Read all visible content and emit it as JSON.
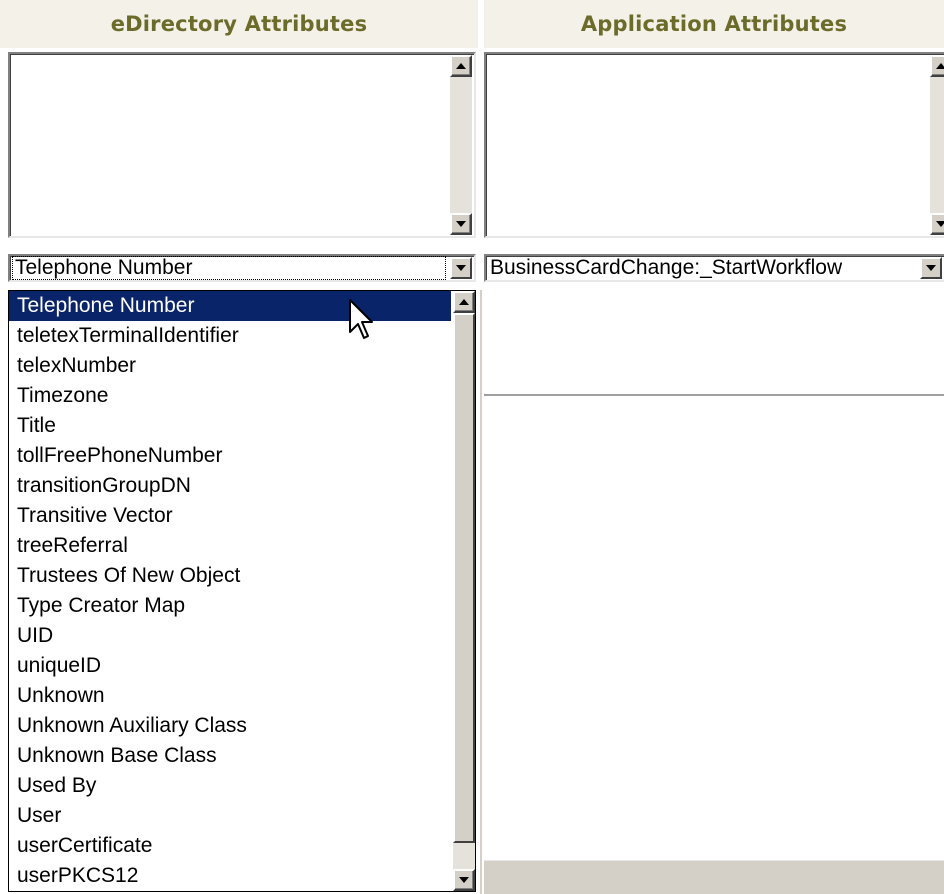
{
  "headers": {
    "left": "eDirectory Attributes",
    "right": "Application Attributes"
  },
  "left_select": {
    "value": "Telephone Number"
  },
  "right_select": {
    "value": "BusinessCardChange:_StartWorkflow"
  },
  "dropdown": {
    "items": [
      "Telephone Number",
      "teletexTerminalIdentifier",
      "telexNumber",
      "Timezone",
      "Title",
      "tollFreePhoneNumber",
      "transitionGroupDN",
      "Transitive Vector",
      "treeReferral",
      "Trustees Of New Object",
      "Type Creator Map",
      "UID",
      "uniqueID",
      "Unknown",
      "Unknown Auxiliary Class",
      "Unknown Base Class",
      "Used By",
      "User",
      "userCertificate",
      "userPKCS12"
    ],
    "selected_index": 0
  },
  "colors": {
    "header_text": "#6b6b2a",
    "header_bg": "#f4f1e9",
    "selection_bg": "#0a246a",
    "chrome": "#d4d0c8"
  },
  "icons": {
    "scroll_up": "scroll-up-arrow-icon",
    "scroll_down": "scroll-down-arrow-icon",
    "dropdown": "dropdown-arrow-icon",
    "cursor": "mouse-pointer-icon"
  }
}
